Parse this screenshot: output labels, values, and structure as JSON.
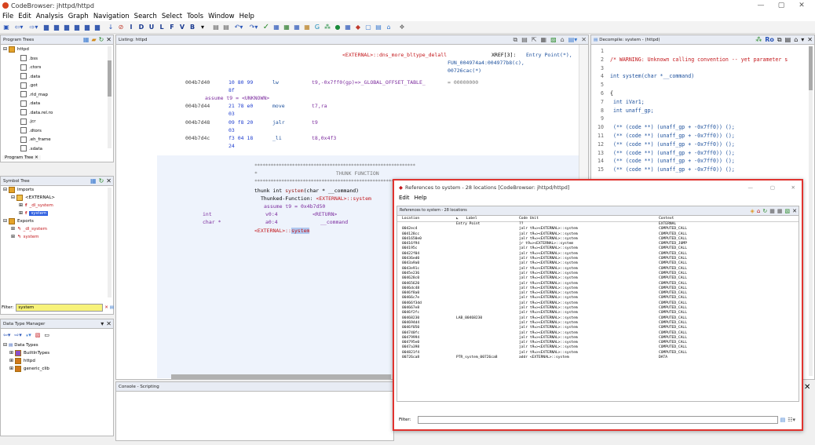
{
  "window": {
    "title": "CodeBrowser: jhttpd/httpd",
    "controls": [
      "—",
      "▢",
      "✕"
    ]
  },
  "menu": [
    "File",
    "Edit",
    "Analysis",
    "Graph",
    "Navigation",
    "Search",
    "Select",
    "Tools",
    "Window",
    "Help"
  ],
  "toolbar_icons": [
    "save-icon",
    "back-icon",
    "forward-icon",
    "bookmark-icons",
    "disassemble-icon",
    "label-icons",
    "undo-icon",
    "redo-icon",
    "checkmark-icon",
    "memory-icons",
    "refresh-icon"
  ],
  "program_trees": {
    "title": "Program Trees",
    "root": "httpd",
    "items": [
      ".bss",
      ".ctors",
      ".data",
      ".got",
      ".rld_map",
      ".data",
      ".data.rel.ro",
      ".jcr",
      ".dtors",
      ".eh_frame",
      ".sdata"
    ],
    "tab": "Program Tree"
  },
  "symbol_tree": {
    "title": "Symbol Tree",
    "imports_label": "Imports",
    "external_label": "<EXTERNAL>",
    "imp1": "_dl_system",
    "imp2": "system",
    "exports_label": "Exports",
    "exp1": "_dl_system",
    "exp2": "system",
    "filter_label": "Filter:",
    "filter_value": "system"
  },
  "data_type_manager": {
    "title": "Data Type Manager",
    "root": "Data Types",
    "items": [
      "BuiltInTypes",
      "httpd",
      "generic_clib"
    ]
  },
  "listing": {
    "title": "Listing: httpd",
    "lines": [
      {
        "addr": "",
        "bytes": "",
        "mnem": "",
        "ops": "<EXTERNAL>::dns_more_bltype_delall",
        "xref": "XREF[3]:",
        "ref": "Entry Point(*),"
      },
      {
        "addr": "",
        "bytes": "",
        "mnem": "",
        "ops": "",
        "xref": "",
        "ref": "FUN_004974a4:004977b8(c),"
      },
      {
        "addr": "",
        "bytes": "",
        "mnem": "",
        "ops": "",
        "xref": "",
        "ref": "00726cac(*)"
      },
      {
        "addr": "004b7d40",
        "bytes": "10 80 99",
        "mnem": "lw",
        "ops": "t9,-0x7ff0(gp)=>_GLOBAL_OFFSET_TABLE_",
        "xref": "",
        "ref": "= 00000000"
      },
      {
        "addr": "",
        "bytes": "8f",
        "mnem": "",
        "ops": "",
        "xref": "",
        "ref": ""
      },
      {
        "addr": "",
        "bytes": "assume t9 = <UNKNOWN>",
        "mnem": "",
        "ops": "",
        "xref": "",
        "ref": ""
      },
      {
        "addr": "004b7d44",
        "bytes": "21 78 e0",
        "mnem": "move",
        "ops": "t7,ra",
        "xref": "",
        "ref": ""
      },
      {
        "addr": "",
        "bytes": "03",
        "mnem": "",
        "ops": "",
        "xref": "",
        "ref": ""
      },
      {
        "addr": "004b7d48",
        "bytes": "09 f8 20",
        "mnem": "jalr",
        "ops": "t9",
        "xref": "",
        "ref": ""
      },
      {
        "addr": "",
        "bytes": "03",
        "mnem": "",
        "ops": "",
        "xref": "",
        "ref": ""
      },
      {
        "addr": "004b7d4c",
        "bytes": "f3 04 18",
        "mnem": "_li",
        "ops": "t8,0x4f3",
        "xref": "",
        "ref": ""
      },
      {
        "addr": "",
        "bytes": "24",
        "mnem": "",
        "ops": "",
        "xref": "",
        "ref": ""
      }
    ],
    "thunk_header": "THUNK FUNCTION",
    "thunk_sig_pre": "thunk int ",
    "thunk_sig_name": "system",
    "thunk_sig_post": "(char * __command)",
    "thunked_label": "Thunked-Function: ",
    "thunked_target": "<EXTERNAL>::system",
    "assume": "assume t9 = 0x4b7d50",
    "ret_type": "int",
    "ret_reg": "v0:4",
    "ret_name": "<RETURN>",
    "arg_type": "char *",
    "arg_reg": "a0:4",
    "arg_name": "__command",
    "ext_label_pre": "<EXTERNAL>::",
    "ext_label_name": "system"
  },
  "console": {
    "title": "Console - Scripting"
  },
  "decompiler": {
    "title": "Decompile: system - (httpd)",
    "lines": [
      {
        "n": "1",
        "t": ""
      },
      {
        "n": "2",
        "t": "/* WARNING: Unknown calling convention -- yet parameter s"
      },
      {
        "n": "3",
        "t": ""
      },
      {
        "n": "4",
        "t": "int system(char *__command)"
      },
      {
        "n": "5",
        "t": ""
      },
      {
        "n": "6",
        "t": "{"
      },
      {
        "n": "7",
        "t": "  int iVar1;"
      },
      {
        "n": "8",
        "t": "  int unaff_gp;"
      },
      {
        "n": "9",
        "t": ""
      },
      {
        "n": "10",
        "t": "  (** (code **) (unaff_gp + -0x7ff0)) ();"
      },
      {
        "n": "11",
        "t": "  (** (code **) (unaff_gp + -0x7ff0)) ();"
      },
      {
        "n": "12",
        "t": "  (** (code **) (unaff_gp + -0x7ff0)) ();"
      },
      {
        "n": "13",
        "t": "  (** (code **) (unaff_gp + -0x7ff0)) ();"
      },
      {
        "n": "14",
        "t": "  (** (code **) (unaff_gp + -0x7ff0)) ();"
      },
      {
        "n": "15",
        "t": "  (** (code **) (unaff_gp + -0x7ff0)) ();"
      }
    ]
  },
  "references": {
    "window_title": "References to system - 28 locations [CodeBrowser: jhttpd/httpd]",
    "menu": [
      "Edit",
      "Help"
    ],
    "panel_title": "References to system - 28 locations",
    "columns": [
      "Location",
      "Label",
      "Code Unit",
      "Context"
    ],
    "rows": [
      {
        "loc": "",
        "label": "Entry Point",
        "code": "??",
        "ctx": "EXTERNAL"
      },
      {
        "loc": "0042ec4",
        "label": "",
        "code": "jalr t9=><EXTERNAL>::system",
        "ctx": "COMPUTED_CALL"
      },
      {
        "loc": "004128cc",
        "label": "",
        "code": "jalr t9=><EXTERNAL>::system",
        "ctx": "COMPUTED_CALL"
      },
      {
        "loc": "0041650e0",
        "label": "",
        "code": "jalr t9=><EXTERNAL>::system",
        "ctx": "COMPUTED_CALL"
      },
      {
        "loc": "00416f94",
        "label": "",
        "code": "jr t9=><EXTERNAL>::system",
        "ctx": "COMPUTED_JUMP"
      },
      {
        "loc": "004195c",
        "label": "",
        "code": "jalr t9=><EXTERNAL>::system",
        "ctx": "COMPUTED_CALL"
      },
      {
        "loc": "00422f04",
        "label": "",
        "code": "jalr t9=><EXTERNAL>::system",
        "ctx": "COMPUTED_CALL"
      },
      {
        "loc": "00436ed0",
        "label": "",
        "code": "jalr t9=><EXTERNAL>::system",
        "ctx": "COMPUTED_CALL"
      },
      {
        "loc": "0043a9a0",
        "label": "",
        "code": "jalr t9=><EXTERNAL>::system",
        "ctx": "COMPUTED_CALL"
      },
      {
        "loc": "0043e91c",
        "label": "",
        "code": "jalr t9=><EXTERNAL>::system",
        "ctx": "COMPUTED_CALL"
      },
      {
        "loc": "0045e236",
        "label": "",
        "code": "jalr t9=><EXTERNAL>::system",
        "ctx": "COMPUTED_CALL"
      },
      {
        "loc": "004628c0",
        "label": "",
        "code": "jalr t9=><EXTERNAL>::system",
        "ctx": "COMPUTED_CALL"
      },
      {
        "loc": "00465620",
        "label": "",
        "code": "jalr t9=><EXTERNAL>::system",
        "ctx": "COMPUTED_CALL"
      },
      {
        "loc": "0046dc48",
        "label": "",
        "code": "jalr t9=><EXTERNAL>::system",
        "ctx": "COMPUTED_CALL"
      },
      {
        "loc": "0046f8a0",
        "label": "",
        "code": "jalr t9=><EXTERNAL>::system",
        "ctx": "COMPUTED_CALL"
      },
      {
        "loc": "00466c7e",
        "label": "",
        "code": "jalr t9=><EXTERNAL>::system",
        "ctx": "COMPUTED_CALL"
      },
      {
        "loc": "00466f3dd",
        "label": "",
        "code": "jalr t9=><EXTERNAL>::system",
        "ctx": "COMPUTED_CALL"
      },
      {
        "loc": "004667e8",
        "label": "",
        "code": "jalr t9=><EXTERNAL>::system",
        "ctx": "COMPUTED_CALL"
      },
      {
        "loc": "0046f2fc",
        "label": "",
        "code": "jalr t9=><EXTERNAL>::system",
        "ctx": "COMPUTED_CALL"
      },
      {
        "loc": "00468230",
        "label": "LAB_00468230",
        "code": "jalr t9=><EXTERNAL>::system",
        "ctx": "COMPUTED_CALL"
      },
      {
        "loc": "004694d4",
        "label": "",
        "code": "jalr t9=><EXTERNAL>::system",
        "ctx": "COMPUTED_CALL"
      },
      {
        "loc": "0046f050",
        "label": "",
        "code": "jalr t9=><EXTERNAL>::system",
        "ctx": "COMPUTED_CALL"
      },
      {
        "loc": "004740fc",
        "label": "",
        "code": "jalr t9=><EXTERNAL>::system",
        "ctx": "COMPUTED_CALL"
      },
      {
        "loc": "00479994",
        "label": "",
        "code": "jalr t9=><EXTERNAL>::system",
        "ctx": "COMPUTED_CALL"
      },
      {
        "loc": "004795e0",
        "label": "",
        "code": "jalr t9=><EXTERNAL>::system",
        "ctx": "COMPUTED_CALL"
      },
      {
        "loc": "0047a398",
        "label": "",
        "code": "jalr t9=><EXTERNAL>::system",
        "ctx": "COMPUTED_CALL"
      },
      {
        "loc": "004821f4",
        "label": "",
        "code": "jalr t9=><EXTERNAL>::system",
        "ctx": "COMPUTED_CALL"
      },
      {
        "loc": "00726ca8",
        "label": "PTR_system_00726ca8",
        "code": "addr <EXTERNAL>::system",
        "ctx": "DATA"
      }
    ],
    "filter_label": "Filter:",
    "filter_value": ""
  },
  "colors": {
    "highlight": "#e0332f",
    "selection": "#b0c8f0",
    "blue": "#1f3ecf",
    "green": "#1a8b1a",
    "red": "#c3171b"
  }
}
